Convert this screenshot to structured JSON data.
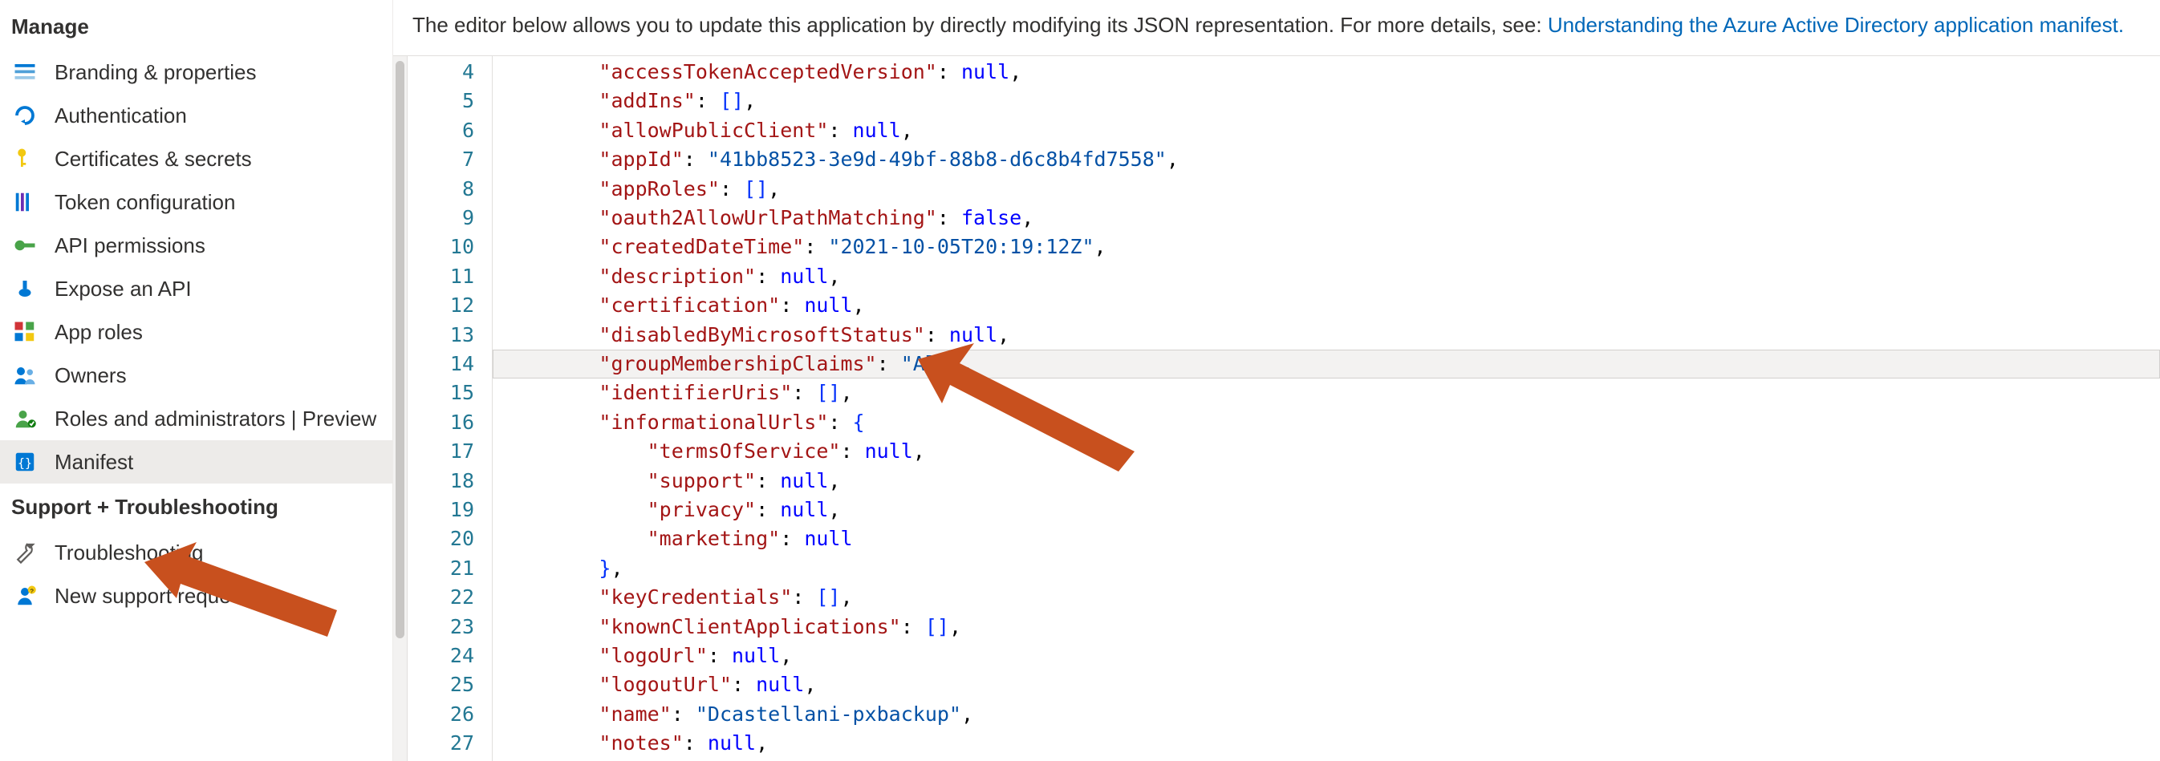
{
  "sidebar": {
    "sections": {
      "manage": {
        "title": "Manage",
        "items": [
          {
            "label": "Branding & properties",
            "icon": "branding"
          },
          {
            "label": "Authentication",
            "icon": "auth"
          },
          {
            "label": "Certificates & secrets",
            "icon": "key"
          },
          {
            "label": "Token configuration",
            "icon": "token"
          },
          {
            "label": "API permissions",
            "icon": "api-perm"
          },
          {
            "label": "Expose an API",
            "icon": "expose-api"
          },
          {
            "label": "App roles",
            "icon": "app-roles"
          },
          {
            "label": "Owners",
            "icon": "owners"
          },
          {
            "label": "Roles and administrators | Preview",
            "icon": "roles-admin"
          },
          {
            "label": "Manifest",
            "icon": "manifest",
            "active": true
          }
        ]
      },
      "support": {
        "title": "Support + Troubleshooting",
        "items": [
          {
            "label": "Troubleshooting",
            "icon": "wrench"
          },
          {
            "label": "New support request",
            "icon": "support-req"
          }
        ]
      }
    }
  },
  "info": {
    "text_before_link": "The editor below allows you to update this application by directly modifying its JSON representation. For more details, see: ",
    "link_text": "Understanding the Azure Active Directory application manifest.",
    "link_url": "#"
  },
  "editor": {
    "first_line_no": 4,
    "highlight_line_no": 14,
    "lines": [
      {
        "indent": 2,
        "tokens": [
          [
            "key",
            "\"accessTokenAcceptedVersion\""
          ],
          [
            "punct",
            ": "
          ],
          [
            "null",
            "null"
          ],
          [
            "punct",
            ","
          ]
        ]
      },
      {
        "indent": 2,
        "tokens": [
          [
            "key",
            "\"addIns\""
          ],
          [
            "punct",
            ": "
          ],
          [
            "brack",
            "[]"
          ],
          [
            "punct",
            ","
          ]
        ]
      },
      {
        "indent": 2,
        "tokens": [
          [
            "key",
            "\"allowPublicClient\""
          ],
          [
            "punct",
            ": "
          ],
          [
            "null",
            "null"
          ],
          [
            "punct",
            ","
          ]
        ]
      },
      {
        "indent": 2,
        "tokens": [
          [
            "key",
            "\"appId\""
          ],
          [
            "punct",
            ": "
          ],
          [
            "str",
            "\"41bb8523-3e9d-49bf-88b8-d6c8b4fd7558\""
          ],
          [
            "punct",
            ","
          ]
        ]
      },
      {
        "indent": 2,
        "tokens": [
          [
            "key",
            "\"appRoles\""
          ],
          [
            "punct",
            ": "
          ],
          [
            "brack",
            "[]"
          ],
          [
            "punct",
            ","
          ]
        ]
      },
      {
        "indent": 2,
        "tokens": [
          [
            "key",
            "\"oauth2AllowUrlPathMatching\""
          ],
          [
            "punct",
            ": "
          ],
          [
            "bool",
            "false"
          ],
          [
            "punct",
            ","
          ]
        ]
      },
      {
        "indent": 2,
        "tokens": [
          [
            "key",
            "\"createdDateTime\""
          ],
          [
            "punct",
            ": "
          ],
          [
            "str",
            "\"2021-10-05T20:19:12Z\""
          ],
          [
            "punct",
            ","
          ]
        ]
      },
      {
        "indent": 2,
        "tokens": [
          [
            "key",
            "\"description\""
          ],
          [
            "punct",
            ": "
          ],
          [
            "null",
            "null"
          ],
          [
            "punct",
            ","
          ]
        ]
      },
      {
        "indent": 2,
        "tokens": [
          [
            "key",
            "\"certification\""
          ],
          [
            "punct",
            ": "
          ],
          [
            "null",
            "null"
          ],
          [
            "punct",
            ","
          ]
        ]
      },
      {
        "indent": 2,
        "tokens": [
          [
            "key",
            "\"disabledByMicrosoftStatus\""
          ],
          [
            "punct",
            ": "
          ],
          [
            "null",
            "null"
          ],
          [
            "punct",
            ","
          ]
        ]
      },
      {
        "indent": 2,
        "tokens": [
          [
            "key",
            "\"groupMembershipClaims\""
          ],
          [
            "punct",
            ": "
          ],
          [
            "str",
            "\"All\""
          ],
          [
            "punct",
            ","
          ]
        ]
      },
      {
        "indent": 2,
        "tokens": [
          [
            "key",
            "\"identifierUris\""
          ],
          [
            "punct",
            ": "
          ],
          [
            "brack",
            "[]"
          ],
          [
            "punct",
            ","
          ]
        ]
      },
      {
        "indent": 2,
        "tokens": [
          [
            "key",
            "\"informationalUrls\""
          ],
          [
            "punct",
            ": "
          ],
          [
            "brack",
            "{"
          ]
        ]
      },
      {
        "indent": 3,
        "tokens": [
          [
            "key",
            "\"termsOfService\""
          ],
          [
            "punct",
            ": "
          ],
          [
            "null",
            "null"
          ],
          [
            "punct",
            ","
          ]
        ]
      },
      {
        "indent": 3,
        "tokens": [
          [
            "key",
            "\"support\""
          ],
          [
            "punct",
            ": "
          ],
          [
            "null",
            "null"
          ],
          [
            "punct",
            ","
          ]
        ]
      },
      {
        "indent": 3,
        "tokens": [
          [
            "key",
            "\"privacy\""
          ],
          [
            "punct",
            ": "
          ],
          [
            "null",
            "null"
          ],
          [
            "punct",
            ","
          ]
        ]
      },
      {
        "indent": 3,
        "tokens": [
          [
            "key",
            "\"marketing\""
          ],
          [
            "punct",
            ": "
          ],
          [
            "null",
            "null"
          ]
        ]
      },
      {
        "indent": 2,
        "tokens": [
          [
            "brack",
            "}"
          ],
          [
            "punct",
            ","
          ]
        ]
      },
      {
        "indent": 2,
        "tokens": [
          [
            "key",
            "\"keyCredentials\""
          ],
          [
            "punct",
            ": "
          ],
          [
            "brack",
            "[]"
          ],
          [
            "punct",
            ","
          ]
        ]
      },
      {
        "indent": 2,
        "tokens": [
          [
            "key",
            "\"knownClientApplications\""
          ],
          [
            "punct",
            ": "
          ],
          [
            "brack",
            "[]"
          ],
          [
            "punct",
            ","
          ]
        ]
      },
      {
        "indent": 2,
        "tokens": [
          [
            "key",
            "\"logoUrl\""
          ],
          [
            "punct",
            ": "
          ],
          [
            "null",
            "null"
          ],
          [
            "punct",
            ","
          ]
        ]
      },
      {
        "indent": 2,
        "tokens": [
          [
            "key",
            "\"logoutUrl\""
          ],
          [
            "punct",
            ": "
          ],
          [
            "null",
            "null"
          ],
          [
            "punct",
            ","
          ]
        ]
      },
      {
        "indent": 2,
        "tokens": [
          [
            "key",
            "\"name\""
          ],
          [
            "punct",
            ": "
          ],
          [
            "str",
            "\"Dcastellani-pxbackup\""
          ],
          [
            "punct",
            ","
          ]
        ]
      },
      {
        "indent": 2,
        "tokens": [
          [
            "key",
            "\"notes\""
          ],
          [
            "punct",
            ": "
          ],
          [
            "null",
            "null"
          ],
          [
            "punct",
            ","
          ]
        ]
      }
    ]
  },
  "annotations": {
    "arrow_color": "#c8501e"
  }
}
